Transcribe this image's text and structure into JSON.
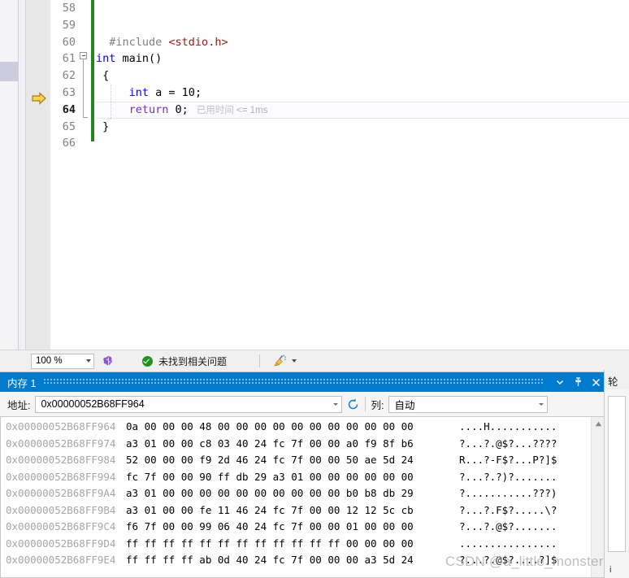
{
  "editor": {
    "lines": [
      {
        "num": "58",
        "current": false,
        "segments": []
      },
      {
        "num": "59",
        "current": false,
        "segments": []
      },
      {
        "num": "60",
        "current": false,
        "segments": [
          {
            "t": "  ",
            "c": "tok-plain"
          },
          {
            "t": "#include ",
            "c": "tok-pre"
          },
          {
            "t": "<stdio.h>",
            "c": "tok-str"
          }
        ]
      },
      {
        "num": "61",
        "current": false,
        "segments": [
          {
            "t": "int",
            "c": "tok-kw"
          },
          {
            "t": " main()",
            "c": "tok-plain"
          }
        ]
      },
      {
        "num": "62",
        "current": false,
        "segments": [
          {
            "t": " {",
            "c": "tok-plain"
          }
        ]
      },
      {
        "num": "63",
        "current": false,
        "segments": [
          {
            "t": "     ",
            "c": "tok-plain"
          },
          {
            "t": "int",
            "c": "tok-kw"
          },
          {
            "t": " a = ",
            "c": "tok-plain"
          },
          {
            "t": "10",
            "c": "tok-num"
          },
          {
            "t": ";",
            "c": "tok-plain"
          }
        ]
      },
      {
        "num": "64",
        "current": true,
        "segments": [
          {
            "t": "     ",
            "c": "tok-plain"
          },
          {
            "t": "return",
            "c": "tok-kw2"
          },
          {
            "t": " 0;",
            "c": "tok-plain"
          }
        ]
      },
      {
        "num": "65",
        "current": false,
        "segments": [
          {
            "t": " }",
            "c": "tok-plain"
          }
        ]
      },
      {
        "num": "66",
        "current": false,
        "segments": []
      }
    ],
    "elapsed_hint_cn": "已用时间",
    "elapsed_hint_val": "<= 1ms",
    "exec_arrow_name": "execution-pointer-arrow",
    "change_bar_color": "#1e8a1e"
  },
  "status_bar": {
    "zoom_value": "100 %",
    "issue_text": "未找到相关问题",
    "ok_color": "#239023"
  },
  "memory_window": {
    "title": "内存 1",
    "accent_color": "#007acc",
    "toolbar": {
      "address_label": "地址:",
      "address_value": "0x00000052B68FF964",
      "columns_label": "列:",
      "columns_value": "自动"
    },
    "rows": [
      {
        "address": "0x00000052B68FF964",
        "hex": "0a 00 00 00 48 00 00 00 00 00 00 00 00 00 00 00",
        "ascii": "....H..........."
      },
      {
        "address": "0x00000052B68FF974",
        "hex": "a3 01 00 00 c8 03 40 24 fc 7f 00 00 a0 f9 8f b6",
        "ascii": "?...?.@$?...????"
      },
      {
        "address": "0x00000052B68FF984",
        "hex": "52 00 00 00 f9 2d 46 24 fc 7f 00 00 50 ae 5d 24",
        "ascii": "R...?-F$?...P?]$"
      },
      {
        "address": "0x00000052B68FF994",
        "hex": "fc 7f 00 00 90 ff db 29 a3 01 00 00 00 00 00 00",
        "ascii": "?...?.?)?......."
      },
      {
        "address": "0x00000052B68FF9A4",
        "hex": "a3 01 00 00 00 00 00 00 00 00 00 00 b0 b8 db 29",
        "ascii": "?...........???)"
      },
      {
        "address": "0x00000052B68FF9B4",
        "hex": "a3 01 00 00 fe 11 46 24 fc 7f 00 00 12 12 5c cb",
        "ascii": "?...?.F$?.....\\?"
      },
      {
        "address": "0x00000052B68FF9C4",
        "hex": "f6 7f 00 00 99 06 40 24 fc 7f 00 00 01 00 00 00",
        "ascii": "?...?.@$?......."
      },
      {
        "address": "0x00000052B68FF9D4",
        "hex": "ff ff ff ff ff ff ff ff ff ff ff ff 00 00 00 00",
        "ascii": "................"
      },
      {
        "address": "0x00000052B68FF9E4",
        "hex": "ff ff ff ff ab 0d 40 24 fc 7f 00 00 00 a3 5d 24",
        "ascii": "?...?.@$?....?]$"
      }
    ]
  },
  "right_panel": {
    "title_fragment": "轮",
    "foot_fragment": "i"
  },
  "watermark": {
    "text": "CSDN @a_little_monster"
  }
}
